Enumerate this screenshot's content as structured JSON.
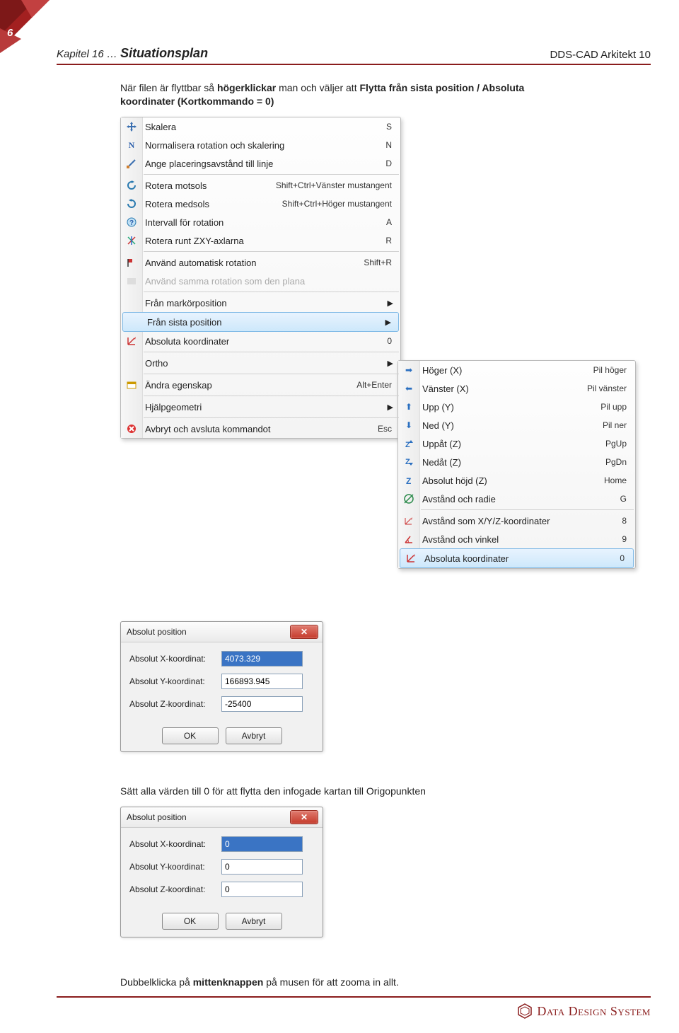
{
  "page_number": "6",
  "header": {
    "chapter": "Kapitel 16 … ",
    "title": "Situationsplan",
    "product": "DDS-CAD Arkitekt 10"
  },
  "para1_html": "När filen är flyttbar så <b>högerklickar</b> man och väljer att <b>Flytta från sista position / Absoluta koordinater (Kortkommando = 0)</b>",
  "para2": "Sätt alla värden till 0 för att flytta den infogade kartan till Origopunkten",
  "para3_html": "Dubbelklicka på <b>mittenknappen</b> på musen för att zooma in allt.",
  "menu": {
    "items": [
      {
        "icon": "move-icon",
        "label": "Skalera",
        "short": "S"
      },
      {
        "icon": "n-icon",
        "label": "Normalisera rotation och skalering",
        "short": "N"
      },
      {
        "icon": "edge-icon",
        "label": "Ange placeringsavstånd till linje",
        "short": "D"
      },
      {
        "sep": true
      },
      {
        "icon": "ccw-icon",
        "label": "Rotera motsols",
        "short": "Shift+Ctrl+Vänster mustangent"
      },
      {
        "icon": "cw-icon",
        "label": "Rotera medsols",
        "short": "Shift+Ctrl+Höger mustangent"
      },
      {
        "icon": "q-icon",
        "label": "Intervall för rotation",
        "short": "A"
      },
      {
        "icon": "axes-icon",
        "label": "Rotera runt ZXY-axlarna",
        "short": "R"
      },
      {
        "sep": true
      },
      {
        "icon": "flag-icon",
        "label": "Använd automatisk rotation",
        "short": "Shift+R"
      },
      {
        "icon": "blank-icon",
        "label": "Använd samma rotation som den plana",
        "disabled": true
      },
      {
        "sep": true
      },
      {
        "icon": "",
        "label": "Från markörposition",
        "arrow": true
      },
      {
        "icon": "",
        "label": "Från sista position",
        "arrow": true,
        "selected": true
      },
      {
        "icon": "abs-icon",
        "label": "Absoluta koordinater",
        "short": "0"
      },
      {
        "sep": true
      },
      {
        "icon": "",
        "label": "Ortho",
        "arrow": true
      },
      {
        "sep": true
      },
      {
        "icon": "prop-icon",
        "label": "Ändra egenskap",
        "short": "Alt+Enter"
      },
      {
        "sep": true
      },
      {
        "icon": "",
        "label": "Hjälpgeometri",
        "arrow": true
      },
      {
        "sep": true
      },
      {
        "icon": "cancel-icon",
        "label": "Avbryt och avsluta kommandot",
        "short": "Esc"
      }
    ]
  },
  "submenu": {
    "items": [
      {
        "icon": "right-icon",
        "label": "Höger (X)",
        "short": "Pil höger"
      },
      {
        "icon": "left-icon",
        "label": "Vänster (X)",
        "short": "Pil vänster"
      },
      {
        "icon": "up-icon",
        "label": "Upp (Y)",
        "short": "Pil upp"
      },
      {
        "icon": "down-icon",
        "label": "Ned (Y)",
        "short": "Pil ner"
      },
      {
        "icon": "zup-icon",
        "label": "Uppåt (Z)",
        "short": "PgUp"
      },
      {
        "icon": "zdn-icon",
        "label": "Nedåt (Z)",
        "short": "PgDn"
      },
      {
        "icon": "zabs-icon",
        "label": "Absolut höjd (Z)",
        "short": "Home"
      },
      {
        "icon": "rad-icon",
        "label": "Avstånd och radie",
        "short": "G"
      },
      {
        "sep": true
      },
      {
        "icon": "xyz-icon",
        "label": "Avstånd som X/Y/Z-koordinater",
        "short": "8"
      },
      {
        "icon": "ang-icon",
        "label": "Avstånd och vinkel",
        "short": "9"
      },
      {
        "icon": "abs2-icon",
        "label": "Absoluta koordinater",
        "short": "0",
        "selected": true
      }
    ]
  },
  "dialog1": {
    "title": "Absolut position",
    "rows": [
      {
        "label": "Absolut X-koordinat:",
        "value": "4073.329",
        "sel": true
      },
      {
        "label": "Absolut Y-koordinat:",
        "value": "166893.945"
      },
      {
        "label": "Absolut Z-koordinat:",
        "value": "-25400"
      }
    ],
    "ok": "OK",
    "cancel": "Avbryt"
  },
  "dialog2": {
    "title": "Absolut position",
    "rows": [
      {
        "label": "Absolut X-koordinat:",
        "value": "0",
        "sel": true
      },
      {
        "label": "Absolut Y-koordinat:",
        "value": "0"
      },
      {
        "label": "Absolut Z-koordinat:",
        "value": "0"
      }
    ],
    "ok": "OK",
    "cancel": "Avbryt"
  },
  "footer_brand": "Data Design System"
}
